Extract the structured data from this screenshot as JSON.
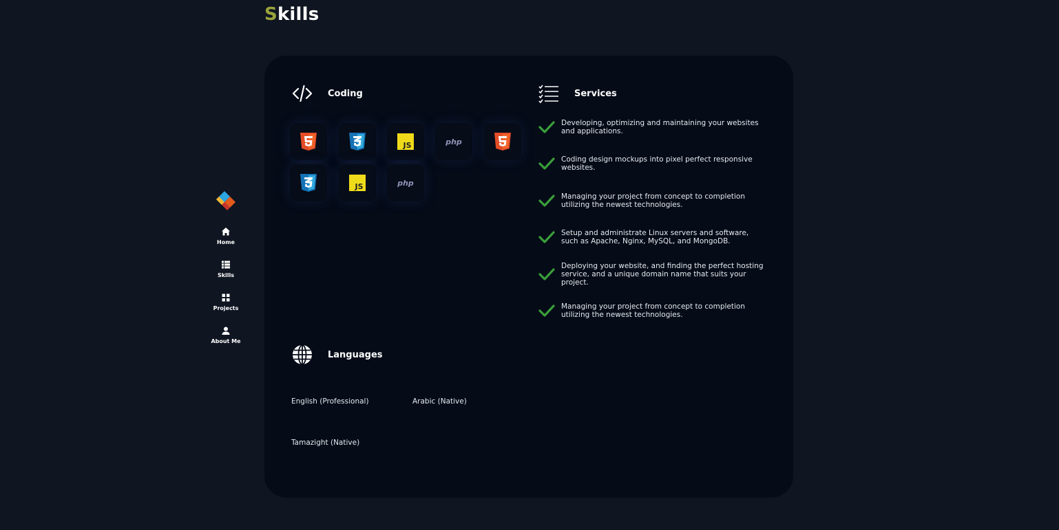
{
  "page": {
    "title_first": "S",
    "title_rest": "kills"
  },
  "sidebar": {
    "logo": "brand-logo",
    "items": [
      {
        "label": "Home",
        "icon": "home-icon"
      },
      {
        "label": "Skills",
        "icon": "list-icon"
      },
      {
        "label": "Projects",
        "icon": "grid-icon"
      },
      {
        "label": "About Me",
        "icon": "user-icon"
      }
    ]
  },
  "coding": {
    "title": "Coding",
    "icon": "code-icon",
    "skills": [
      {
        "name": "html5",
        "icon": "html5-icon"
      },
      {
        "name": "css3",
        "icon": "css3-icon"
      },
      {
        "name": "javascript",
        "icon": "js-icon",
        "text": "JS"
      },
      {
        "name": "php",
        "icon": "php-icon",
        "text": "php"
      },
      {
        "name": "html5",
        "icon": "html5-icon"
      },
      {
        "name": "css3",
        "icon": "css3-icon"
      },
      {
        "name": "javascript",
        "icon": "js-icon",
        "text": "JS"
      },
      {
        "name": "php",
        "icon": "php-icon",
        "text": "php"
      }
    ]
  },
  "services": {
    "title": "Services",
    "icon": "checklist-icon",
    "items": [
      "Developing, optimizing and maintaining your websites and applications.",
      "Coding design mockups into pixel perfect responsive websites.",
      "Managing your project from concept to completion utilizing the newest technologies.",
      "Setup and administrate Linux servers and software, such as Apache, Nginx, MySQL, and MongoDB.",
      "Deploying your website, and finding the perfect hosting service, and a unique domain name that suits your project.",
      "Managing your project from concept to completion utilizing the newest technologies."
    ]
  },
  "languages": {
    "title": "Languages",
    "icon": "globe-icon",
    "items": [
      "English (Professional)",
      "Arabic (Native)",
      "Tamazight (Native)"
    ]
  },
  "colors": {
    "background": "#0f1521",
    "card": "#050b17",
    "accent": "#9aa33b",
    "check": "#3a9e3a",
    "html5": "#e44d26",
    "css3": "#1572b6",
    "js": "#f0db1a"
  }
}
